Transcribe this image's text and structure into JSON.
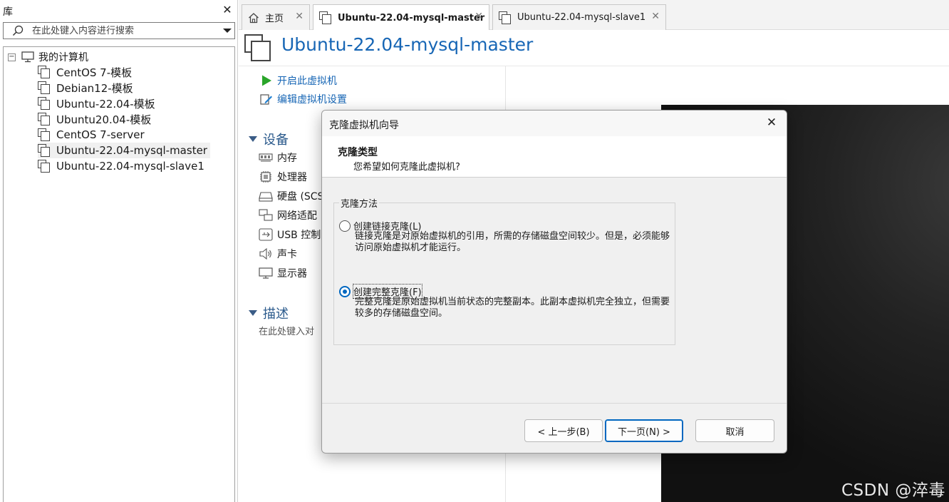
{
  "library": {
    "title": "库",
    "search_placeholder": "在此处键入内容进行搜索",
    "tree": {
      "root_label": "我的计算机",
      "items": [
        {
          "label": "CentOS 7-模板"
        },
        {
          "label": "Debian12-模板"
        },
        {
          "label": "Ubuntu-22.04-模板"
        },
        {
          "label": "Ubuntu20.04-模板"
        },
        {
          "label": "CentOS 7-server"
        },
        {
          "label": "Ubuntu-22.04-mysql-master"
        },
        {
          "label": "Ubuntu-22.04-mysql-slave1"
        }
      ],
      "selected": "Ubuntu-22.04-mysql-master"
    }
  },
  "tabs": [
    {
      "label": "主页"
    },
    {
      "label": "Ubuntu-22.04-mysql-master"
    },
    {
      "label": "Ubuntu-22.04-mysql-slave1"
    }
  ],
  "vm": {
    "title": "Ubuntu-22.04-mysql-master",
    "actions": {
      "power_on": "开启此虚拟机",
      "edit_settings": "编辑虚拟机设置"
    },
    "devices_heading": "设备",
    "devices": [
      {
        "label": "内存"
      },
      {
        "label": "处理器"
      },
      {
        "label": "硬盘 (SCS"
      },
      {
        "label": "网络适配"
      },
      {
        "label": "USB 控制"
      },
      {
        "label": "声卡"
      },
      {
        "label": "显示器"
      }
    ],
    "description_heading": "描述",
    "description_placeholder": "在此处键入对"
  },
  "dialog": {
    "title": "克隆虚拟机向导",
    "heading": "克隆类型",
    "subheading": "您希望如何克隆此虚拟机?",
    "group_label": "克隆方法",
    "options": [
      {
        "label": "创建链接克隆(L)",
        "description": "链接克隆是对原始虚拟机的引用，所需的存储磁盘空间较少。但是，必须能够访问原始虚拟机才能运行。",
        "checked": false
      },
      {
        "label": "创建完整克隆(F)",
        "description": "完整克隆是原始虚拟机当前状态的完整副本。此副本虚拟机完全独立，但需要较多的存储磁盘空间。",
        "checked": true
      }
    ],
    "buttons": {
      "back": "< 上一步(B)",
      "next": "下一页(N) >",
      "cancel": "取消"
    }
  },
  "watermark": "CSDN @淬毒",
  "colors": {
    "link": "#1766b5",
    "accent": "#0067c0",
    "power_green": "#2aa52a",
    "section": "#2b5a8c"
  }
}
